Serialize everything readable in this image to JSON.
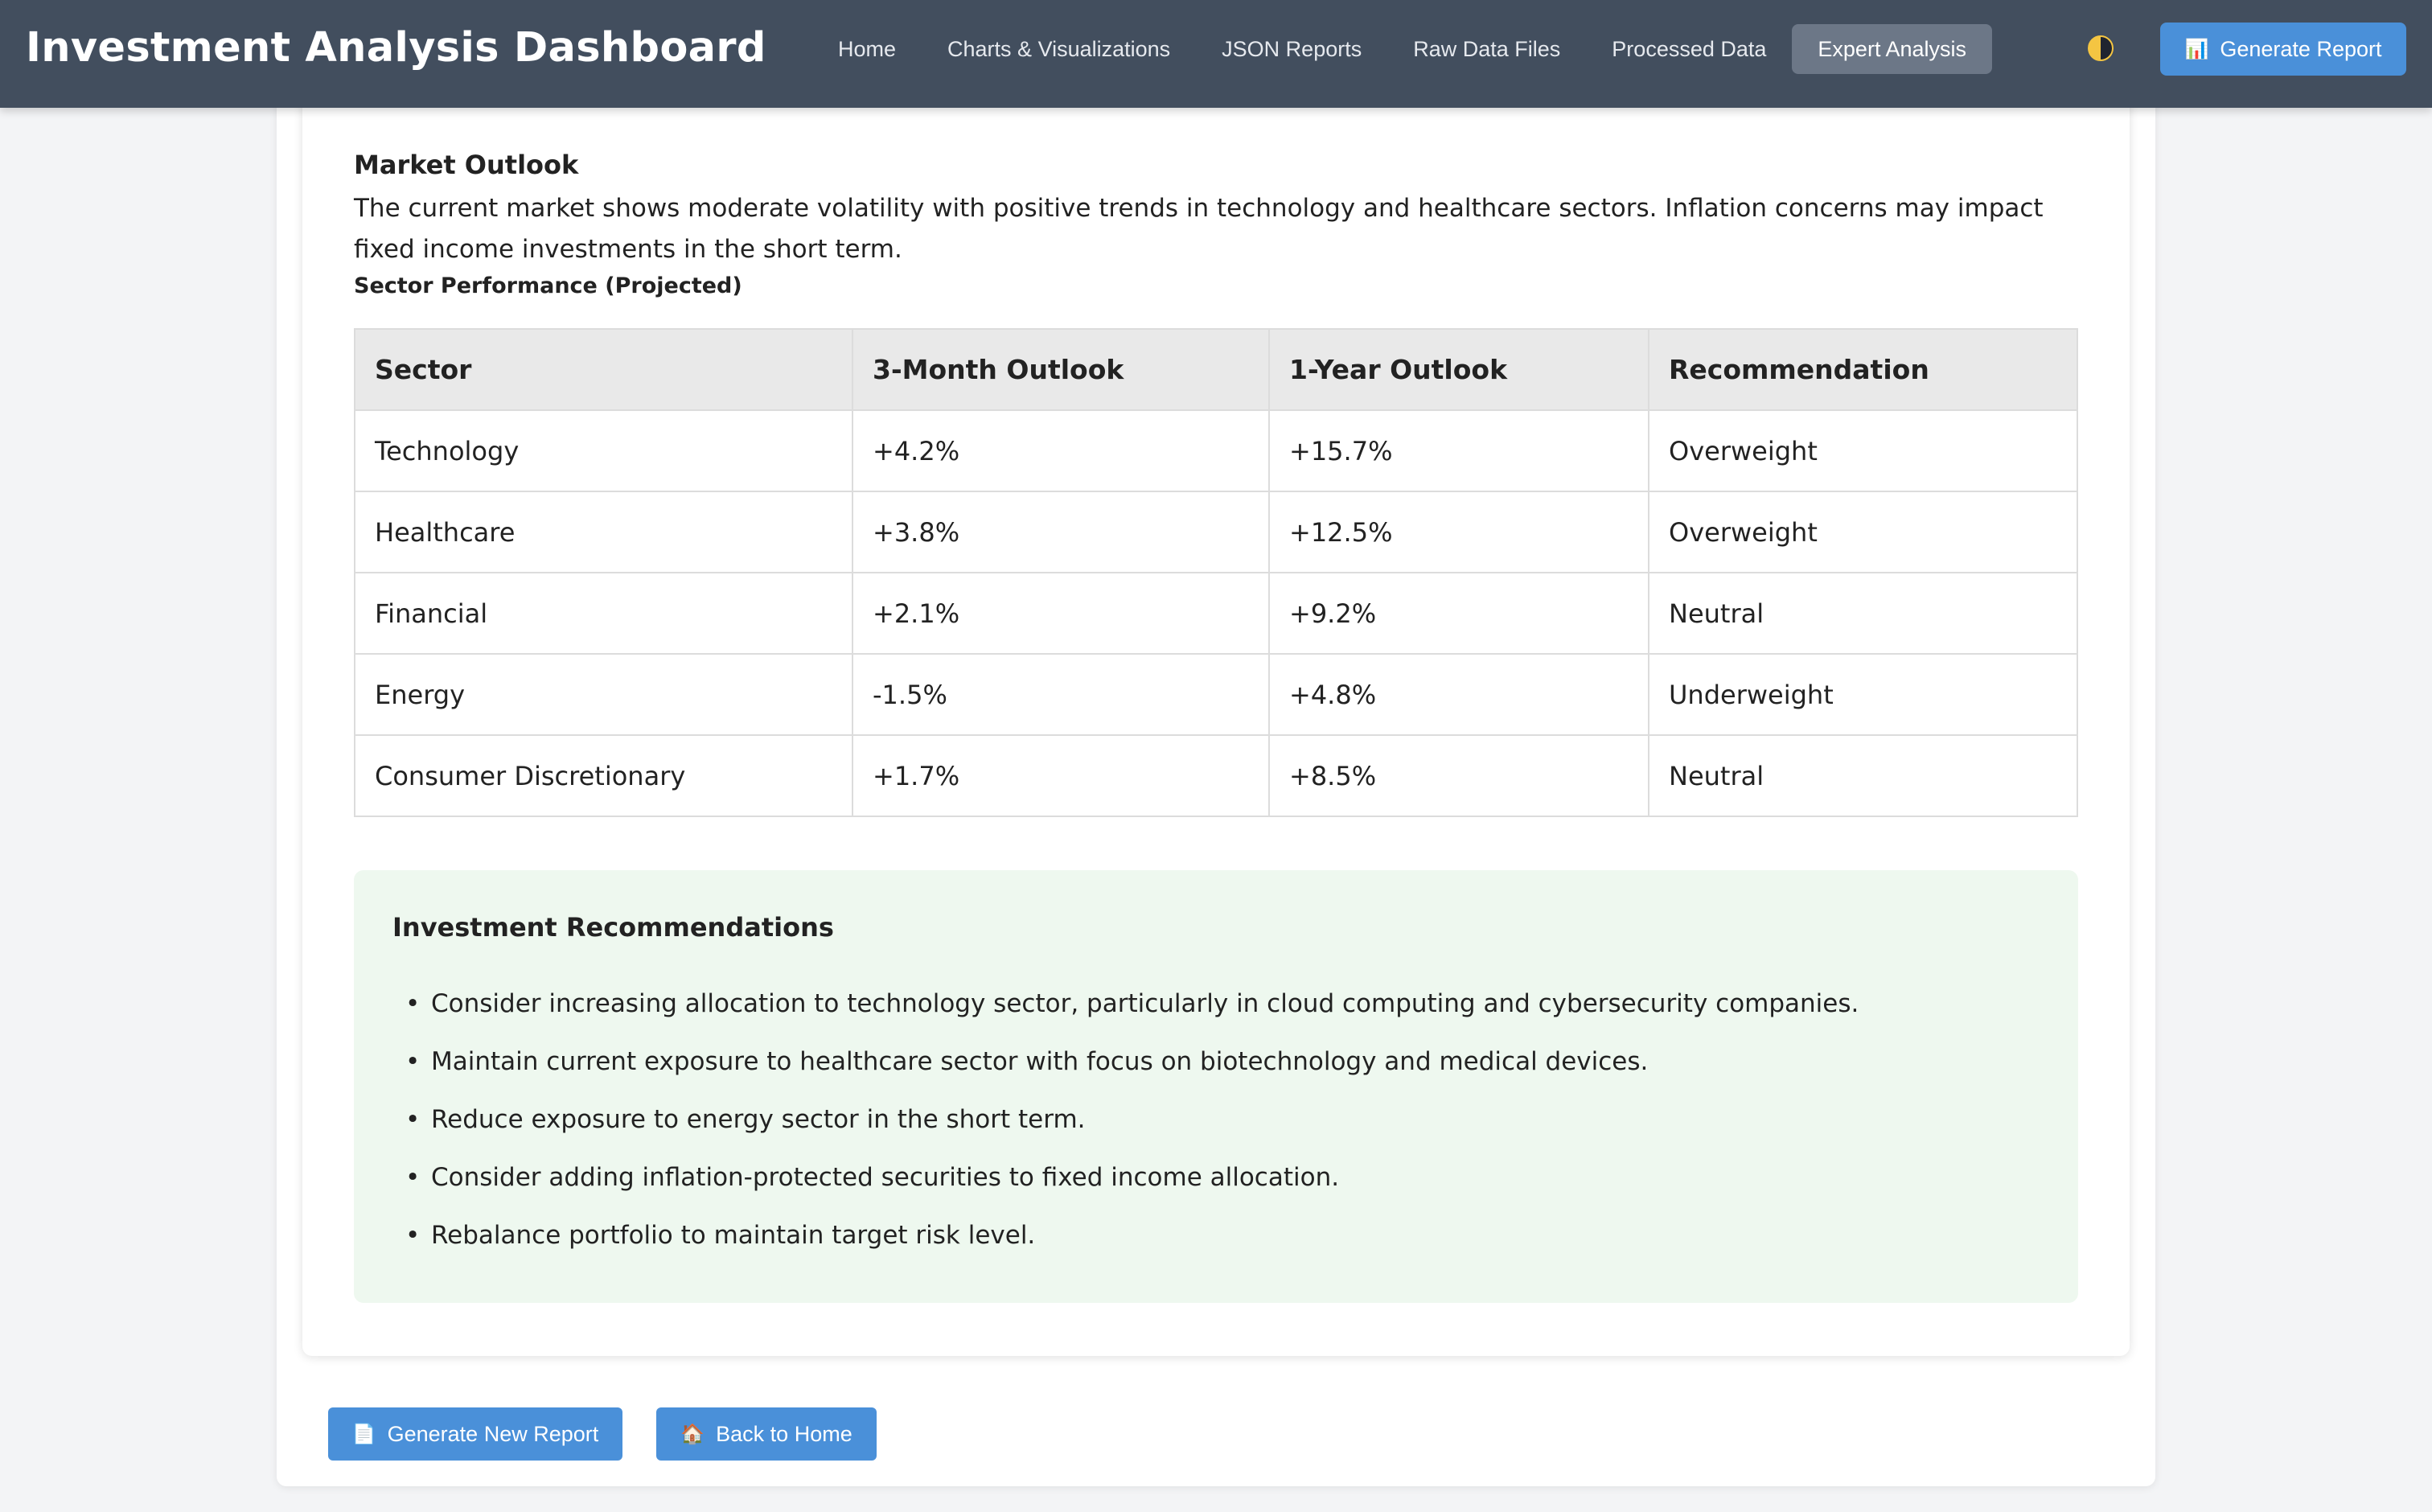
{
  "header": {
    "title": "Investment Analysis Dashboard",
    "nav": [
      {
        "label": "Home"
      },
      {
        "label": "Charts & Visualizations"
      },
      {
        "label": "JSON Reports"
      },
      {
        "label": "Raw Data Files"
      },
      {
        "label": "Processed Data"
      },
      {
        "label": "Expert Analysis",
        "active": true
      }
    ],
    "theme_toggle_icon": "half-moon-icon",
    "generate_icon": "📊",
    "generate_label": "Generate Report"
  },
  "market_outlook": {
    "title": "Market Outlook",
    "text": "The current market shows moderate volatility with positive trends in technology and healthcare sectors. Inflation concerns may impact fixed income investments in the short term."
  },
  "sector_table": {
    "caption": "Sector Performance (Projected)",
    "headers": [
      "Sector",
      "3-Month Outlook",
      "1-Year Outlook",
      "Recommendation"
    ],
    "rows": [
      [
        "Technology",
        "+4.2%",
        "+15.7%",
        "Overweight"
      ],
      [
        "Healthcare",
        "+3.8%",
        "+12.5%",
        "Overweight"
      ],
      [
        "Financial",
        "+2.1%",
        "+9.2%",
        "Neutral"
      ],
      [
        "Energy",
        "-1.5%",
        "+4.8%",
        "Underweight"
      ],
      [
        "Consumer Discretionary",
        "+1.7%",
        "+8.5%",
        "Neutral"
      ]
    ]
  },
  "recommendations": {
    "title": "Investment Recommendations",
    "bullet": "•",
    "items": [
      "Consider increasing allocation to technology sector, particularly in cloud computing and cybersecurity companies.",
      "Maintain current exposure to healthcare sector with focus on biotechnology and medical devices.",
      "Reduce exposure to energy sector in the short term.",
      "Consider adding inflation-protected securities to fixed income allocation.",
      "Rebalance portfolio to maintain target risk level."
    ]
  },
  "footer": {
    "new_report_icon": "📄",
    "new_report_label": "Generate New Report",
    "home_icon": "🏠",
    "home_label": "Back to Home"
  },
  "colors": {
    "header_bg": "#424e5e",
    "accent": "#4a90d9",
    "nav_active_bg": "#6c7787",
    "reco_bg": "#eef8ef"
  }
}
